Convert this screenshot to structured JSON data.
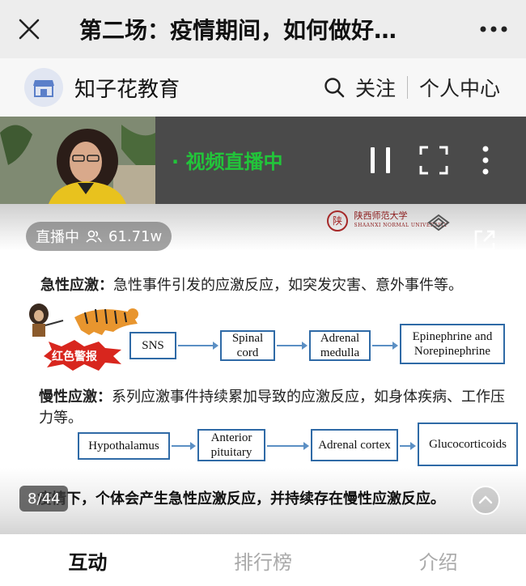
{
  "header": {
    "title": "第二场：疫情期间，如何做好…",
    "close_icon": "close-icon",
    "more_icon": "more-icon"
  },
  "channel": {
    "name": "知子花教育",
    "follow_label": "关注",
    "user_center_label": "个人中心"
  },
  "live": {
    "status_text": "· 视频直播中",
    "status_color": "#22c53a"
  },
  "slide": {
    "live_badge_label": "直播中",
    "viewer_count": "61.71w",
    "university_name": "陕西师范大学",
    "university_name_en": "SHAANXI NORMAL UNIVERSITY",
    "acute_title": "急性应激：",
    "acute_text": "急性事件引发的应激反应，如突发灾害、意外事件等。",
    "alarm_label": "红色警报",
    "acute_flow": [
      "SNS",
      "Spinal cord",
      "Adrenal medulla",
      "Epinephrine and Norepinephrine"
    ],
    "chronic_title": "慢性应激：",
    "chronic_text": "系列应激事件持续累加导致的应激反应，如身体疾病、工作压力等。",
    "chronic_flow": [
      "Hypothalamus",
      "Anterior pituitary",
      "Adrenal cortex",
      "Glucocorticoids"
    ],
    "caption": "疫情下，个体会产生急性应激反应，并持续存在慢性应激反应。",
    "page_indicator": "8/44"
  },
  "tabs": [
    {
      "label": "互动",
      "active": true
    },
    {
      "label": "排行榜",
      "active": false
    },
    {
      "label": "介绍",
      "active": false
    }
  ]
}
